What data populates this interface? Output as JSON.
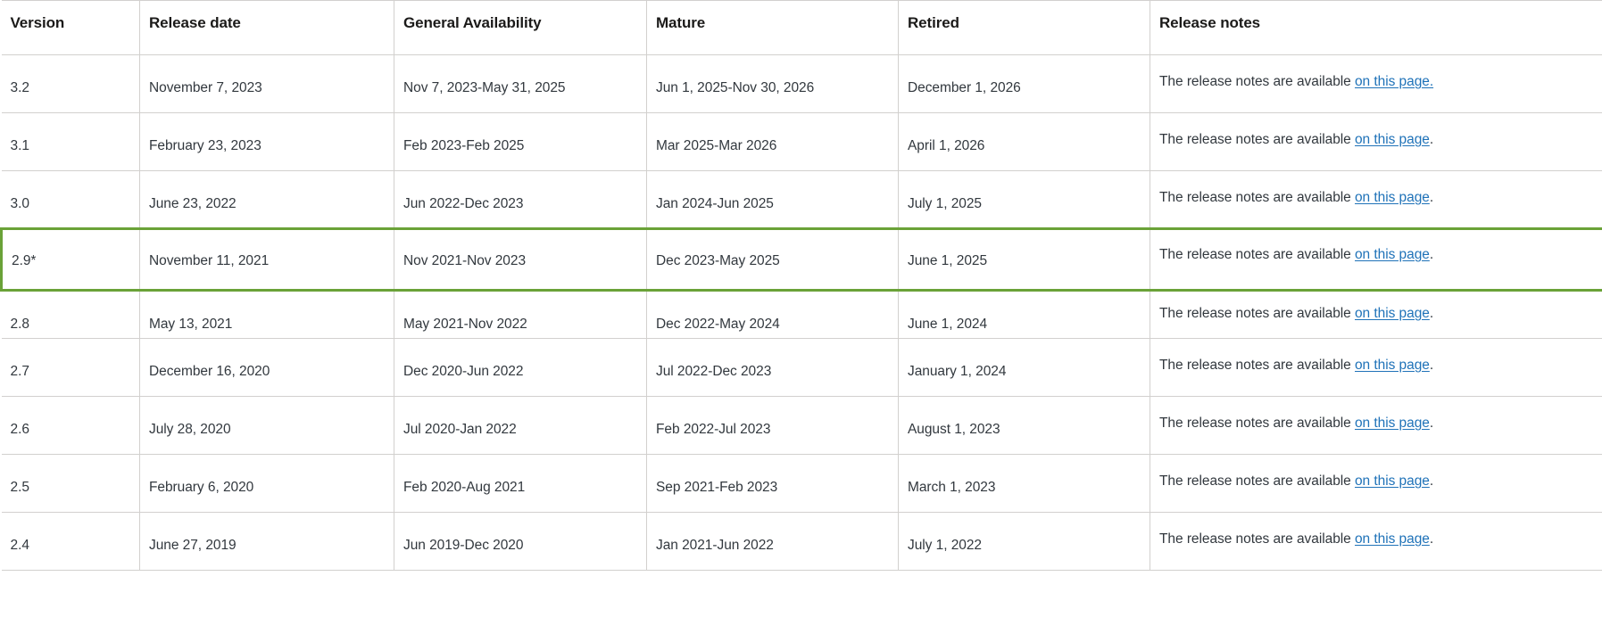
{
  "table": {
    "columns": [
      {
        "key": "version",
        "label": "Version"
      },
      {
        "key": "release_date",
        "label": "Release date"
      },
      {
        "key": "general_availability",
        "label": "General Availability"
      },
      {
        "key": "mature",
        "label": "Mature"
      },
      {
        "key": "retired",
        "label": "Retired"
      },
      {
        "key": "release_notes",
        "label": "Release notes"
      }
    ],
    "note_prefix": "The release notes are available ",
    "note_link_label": "on this page",
    "note_suffix": ".",
    "highlight_color": "#6aa238",
    "link_color": "#1f72b8",
    "border_color": "#d2d0ce",
    "rows": [
      {
        "version": "3.2",
        "release_date": "November 7, 2023",
        "general_availability": "Nov 7, 2023-May 31, 2025",
        "mature": "Jun 1, 2025-Nov 30, 2026",
        "retired": "December 1, 2026",
        "note_prefix": "The release notes are available ",
        "note_link_label": "on this page.",
        "note_suffix": "",
        "highlighted": false
      },
      {
        "version": "3.1",
        "release_date": "February 23, 2023",
        "general_availability": "Feb 2023-Feb 2025",
        "mature": "Mar 2025-Mar 2026",
        "retired": "April 1, 2026",
        "note_prefix": "The release notes are available ",
        "note_link_label": "on this page",
        "note_suffix": ".",
        "highlighted": false
      },
      {
        "version": "3.0",
        "release_date": "June 23, 2022",
        "general_availability": "Jun 2022-Dec 2023",
        "mature": "Jan 2024-Jun 2025",
        "retired": "July 1, 2025",
        "note_prefix": "The release notes are available ",
        "note_link_label": "on this page",
        "note_suffix": ".",
        "highlighted": false
      },
      {
        "version": "2.9*",
        "release_date": "November 11, 2021",
        "general_availability": "Nov 2021-Nov 2023",
        "mature": "Dec 2023-May 2025",
        "retired": "June 1, 2025",
        "note_prefix": "The release notes are available ",
        "note_link_label": "on this page",
        "note_suffix": ".",
        "highlighted": true
      },
      {
        "version": "2.8",
        "release_date": "May 13, 2021",
        "general_availability": "May 2021-Nov 2022",
        "mature": "Dec 2022-May 2024",
        "retired": "June 1, 2024",
        "note_prefix": "The release notes are available ",
        "note_link_label": "on this page",
        "note_suffix": ".",
        "highlighted": false
      },
      {
        "version": "2.7",
        "release_date": "December 16, 2020",
        "general_availability": "Dec 2020-Jun 2022",
        "mature": "Jul 2022-Dec 2023",
        "retired": "January 1, 2024",
        "note_prefix": "The release notes are available ",
        "note_link_label": "on this page",
        "note_suffix": ".",
        "highlighted": false
      },
      {
        "version": "2.6",
        "release_date": "July 28, 2020",
        "general_availability": "Jul 2020-Jan 2022",
        "mature": "Feb 2022-Jul 2023",
        "retired": "August 1, 2023",
        "note_prefix": "The release notes are available ",
        "note_link_label": "on this page",
        "note_suffix": ".",
        "highlighted": false
      },
      {
        "version": "2.5",
        "release_date": "February 6, 2020",
        "general_availability": "Feb 2020-Aug 2021",
        "mature": "Sep 2021-Feb 2023",
        "retired": "March 1, 2023",
        "note_prefix": "The release notes are available ",
        "note_link_label": "on this page",
        "note_suffix": ".",
        "highlighted": false
      },
      {
        "version": "2.4",
        "release_date": "June 27, 2019",
        "general_availability": "Jun 2019-Dec 2020",
        "mature": "Jan 2021-Jun 2022",
        "retired": "July 1, 2022",
        "note_prefix": "The release notes are available ",
        "note_link_label": "on this page",
        "note_suffix": ".",
        "highlighted": false
      }
    ]
  }
}
